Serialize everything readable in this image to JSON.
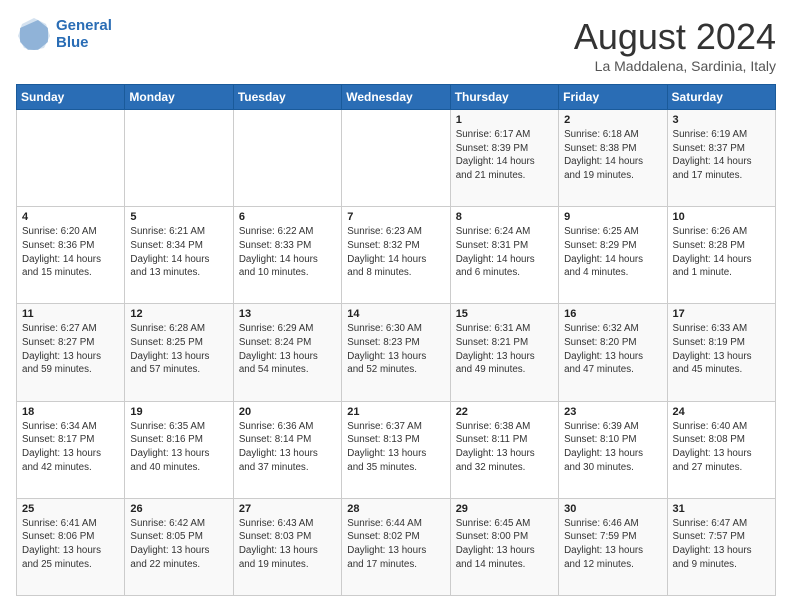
{
  "logo": {
    "line1": "General",
    "line2": "Blue"
  },
  "title": "August 2024",
  "location": "La Maddalena, Sardinia, Italy",
  "days_header": [
    "Sunday",
    "Monday",
    "Tuesday",
    "Wednesday",
    "Thursday",
    "Friday",
    "Saturday"
  ],
  "weeks": [
    [
      {
        "day": "",
        "info": ""
      },
      {
        "day": "",
        "info": ""
      },
      {
        "day": "",
        "info": ""
      },
      {
        "day": "",
        "info": ""
      },
      {
        "day": "1",
        "info": "Sunrise: 6:17 AM\nSunset: 8:39 PM\nDaylight: 14 hours\nand 21 minutes."
      },
      {
        "day": "2",
        "info": "Sunrise: 6:18 AM\nSunset: 8:38 PM\nDaylight: 14 hours\nand 19 minutes."
      },
      {
        "day": "3",
        "info": "Sunrise: 6:19 AM\nSunset: 8:37 PM\nDaylight: 14 hours\nand 17 minutes."
      }
    ],
    [
      {
        "day": "4",
        "info": "Sunrise: 6:20 AM\nSunset: 8:36 PM\nDaylight: 14 hours\nand 15 minutes."
      },
      {
        "day": "5",
        "info": "Sunrise: 6:21 AM\nSunset: 8:34 PM\nDaylight: 14 hours\nand 13 minutes."
      },
      {
        "day": "6",
        "info": "Sunrise: 6:22 AM\nSunset: 8:33 PM\nDaylight: 14 hours\nand 10 minutes."
      },
      {
        "day": "7",
        "info": "Sunrise: 6:23 AM\nSunset: 8:32 PM\nDaylight: 14 hours\nand 8 minutes."
      },
      {
        "day": "8",
        "info": "Sunrise: 6:24 AM\nSunset: 8:31 PM\nDaylight: 14 hours\nand 6 minutes."
      },
      {
        "day": "9",
        "info": "Sunrise: 6:25 AM\nSunset: 8:29 PM\nDaylight: 14 hours\nand 4 minutes."
      },
      {
        "day": "10",
        "info": "Sunrise: 6:26 AM\nSunset: 8:28 PM\nDaylight: 14 hours\nand 1 minute."
      }
    ],
    [
      {
        "day": "11",
        "info": "Sunrise: 6:27 AM\nSunset: 8:27 PM\nDaylight: 13 hours\nand 59 minutes."
      },
      {
        "day": "12",
        "info": "Sunrise: 6:28 AM\nSunset: 8:25 PM\nDaylight: 13 hours\nand 57 minutes."
      },
      {
        "day": "13",
        "info": "Sunrise: 6:29 AM\nSunset: 8:24 PM\nDaylight: 13 hours\nand 54 minutes."
      },
      {
        "day": "14",
        "info": "Sunrise: 6:30 AM\nSunset: 8:23 PM\nDaylight: 13 hours\nand 52 minutes."
      },
      {
        "day": "15",
        "info": "Sunrise: 6:31 AM\nSunset: 8:21 PM\nDaylight: 13 hours\nand 49 minutes."
      },
      {
        "day": "16",
        "info": "Sunrise: 6:32 AM\nSunset: 8:20 PM\nDaylight: 13 hours\nand 47 minutes."
      },
      {
        "day": "17",
        "info": "Sunrise: 6:33 AM\nSunset: 8:19 PM\nDaylight: 13 hours\nand 45 minutes."
      }
    ],
    [
      {
        "day": "18",
        "info": "Sunrise: 6:34 AM\nSunset: 8:17 PM\nDaylight: 13 hours\nand 42 minutes."
      },
      {
        "day": "19",
        "info": "Sunrise: 6:35 AM\nSunset: 8:16 PM\nDaylight: 13 hours\nand 40 minutes."
      },
      {
        "day": "20",
        "info": "Sunrise: 6:36 AM\nSunset: 8:14 PM\nDaylight: 13 hours\nand 37 minutes."
      },
      {
        "day": "21",
        "info": "Sunrise: 6:37 AM\nSunset: 8:13 PM\nDaylight: 13 hours\nand 35 minutes."
      },
      {
        "day": "22",
        "info": "Sunrise: 6:38 AM\nSunset: 8:11 PM\nDaylight: 13 hours\nand 32 minutes."
      },
      {
        "day": "23",
        "info": "Sunrise: 6:39 AM\nSunset: 8:10 PM\nDaylight: 13 hours\nand 30 minutes."
      },
      {
        "day": "24",
        "info": "Sunrise: 6:40 AM\nSunset: 8:08 PM\nDaylight: 13 hours\nand 27 minutes."
      }
    ],
    [
      {
        "day": "25",
        "info": "Sunrise: 6:41 AM\nSunset: 8:06 PM\nDaylight: 13 hours\nand 25 minutes."
      },
      {
        "day": "26",
        "info": "Sunrise: 6:42 AM\nSunset: 8:05 PM\nDaylight: 13 hours\nand 22 minutes."
      },
      {
        "day": "27",
        "info": "Sunrise: 6:43 AM\nSunset: 8:03 PM\nDaylight: 13 hours\nand 19 minutes."
      },
      {
        "day": "28",
        "info": "Sunrise: 6:44 AM\nSunset: 8:02 PM\nDaylight: 13 hours\nand 17 minutes."
      },
      {
        "day": "29",
        "info": "Sunrise: 6:45 AM\nSunset: 8:00 PM\nDaylight: 13 hours\nand 14 minutes."
      },
      {
        "day": "30",
        "info": "Sunrise: 6:46 AM\nSunset: 7:59 PM\nDaylight: 13 hours\nand 12 minutes."
      },
      {
        "day": "31",
        "info": "Sunrise: 6:47 AM\nSunset: 7:57 PM\nDaylight: 13 hours\nand 9 minutes."
      }
    ]
  ]
}
